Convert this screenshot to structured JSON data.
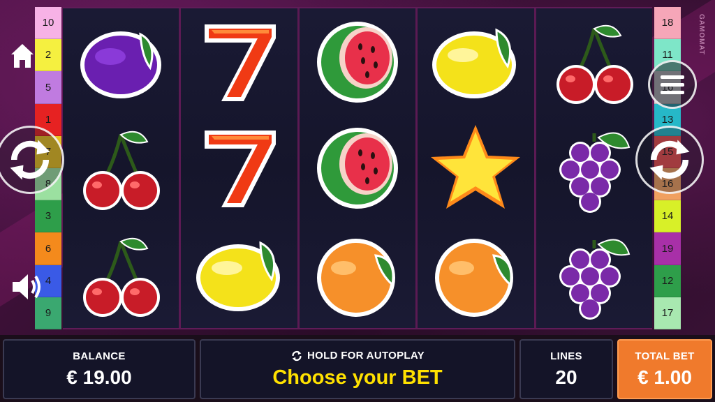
{
  "brand": "GAMOMAT",
  "left_lines": [
    {
      "num": "10",
      "color": "#f7b2e6"
    },
    {
      "num": "2",
      "color": "#f5f040"
    },
    {
      "num": "5",
      "color": "#c07be0"
    },
    {
      "num": "1",
      "color": "#e62222"
    },
    {
      "num": "7",
      "color": "#e8c020"
    },
    {
      "num": "8",
      "color": "#9be0a0"
    },
    {
      "num": "3",
      "color": "#2e9e4a"
    },
    {
      "num": "6",
      "color": "#f48a1c"
    },
    {
      "num": "4",
      "color": "#3a5ae6"
    },
    {
      "num": "9",
      "color": "#3aa870"
    }
  ],
  "right_lines": [
    {
      "num": "18",
      "color": "#f6a6b8"
    },
    {
      "num": "11",
      "color": "#7ee6c8"
    },
    {
      "num": "16",
      "color": "#d8d8d8"
    },
    {
      "num": "13",
      "color": "#26b8c8"
    },
    {
      "num": "15",
      "color": "#e84c4c"
    },
    {
      "num": "16",
      "color": "#f0a060"
    },
    {
      "num": "14",
      "color": "#d8f028"
    },
    {
      "num": "19",
      "color": "#a830a8"
    },
    {
      "num": "12",
      "color": "#2e9e4a"
    },
    {
      "num": "17",
      "color": "#a8e8b0"
    }
  ],
  "reels": [
    [
      "plum",
      "cherries",
      "cherries"
    ],
    [
      "seven",
      "seven",
      "lemon"
    ],
    [
      "watermelon",
      "watermelon",
      "orange"
    ],
    [
      "lemon",
      "star",
      "orange"
    ],
    [
      "cherries",
      "grapes",
      "grapes"
    ]
  ],
  "icons": {
    "home": "home-icon",
    "menu": "menu-icon",
    "sound": "speaker-icon",
    "spin": "spin-icon",
    "autoplay": "autoplay-icon"
  },
  "bottom": {
    "balance_label": "BALANCE",
    "balance_value": "€ 19.00",
    "autoplay_label": "HOLD FOR AUTOPLAY",
    "message": "Choose your BET",
    "lines_label": "LINES",
    "lines_value": "20",
    "totalbet_label": "TOTAL BET",
    "totalbet_value": "€ 1.00"
  },
  "colors": {
    "reel_bg": "#141428",
    "accent": "#ffe100",
    "totalbet_bg": "#f07a2c"
  }
}
